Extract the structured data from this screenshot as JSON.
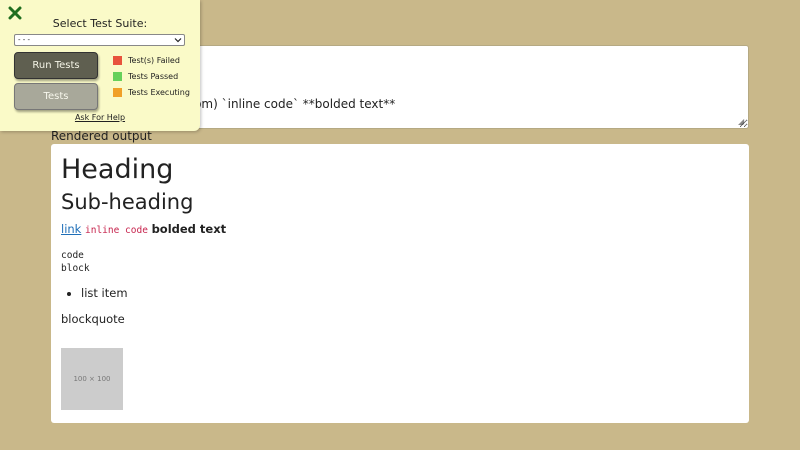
{
  "editor": {
    "source": "# Heading\n## Sub-heading\n[link](http://example.com) `inline code` **bolded text**\n\n    code\n    block"
  },
  "rendered": {
    "label": "Rendered output",
    "heading": "Heading",
    "subheading": "Sub-heading",
    "link_text": "link",
    "inline_code": "inline code",
    "bold_text": "bolded text",
    "code_block": "code\nblock",
    "list_items": [
      "list item"
    ],
    "blockquote": "blockquote",
    "image_placeholder": "100 × 100"
  },
  "test_panel": {
    "title": "Select Test Suite:",
    "selected_suite": "- - -",
    "run_button": "Run Tests",
    "tests_button": "Tests",
    "legend": {
      "failed": "Test(s) Failed",
      "passed": "Tests Passed",
      "executing": "Tests Executing"
    },
    "help_link": "Ask For Help",
    "close_icon": "close-icon"
  },
  "colors": {
    "background": "#c9b88a",
    "panel": "#fafac8",
    "failed": "#e8533c",
    "passed": "#66d05a",
    "executing": "#f0a028",
    "close": "#1f6e1f"
  }
}
